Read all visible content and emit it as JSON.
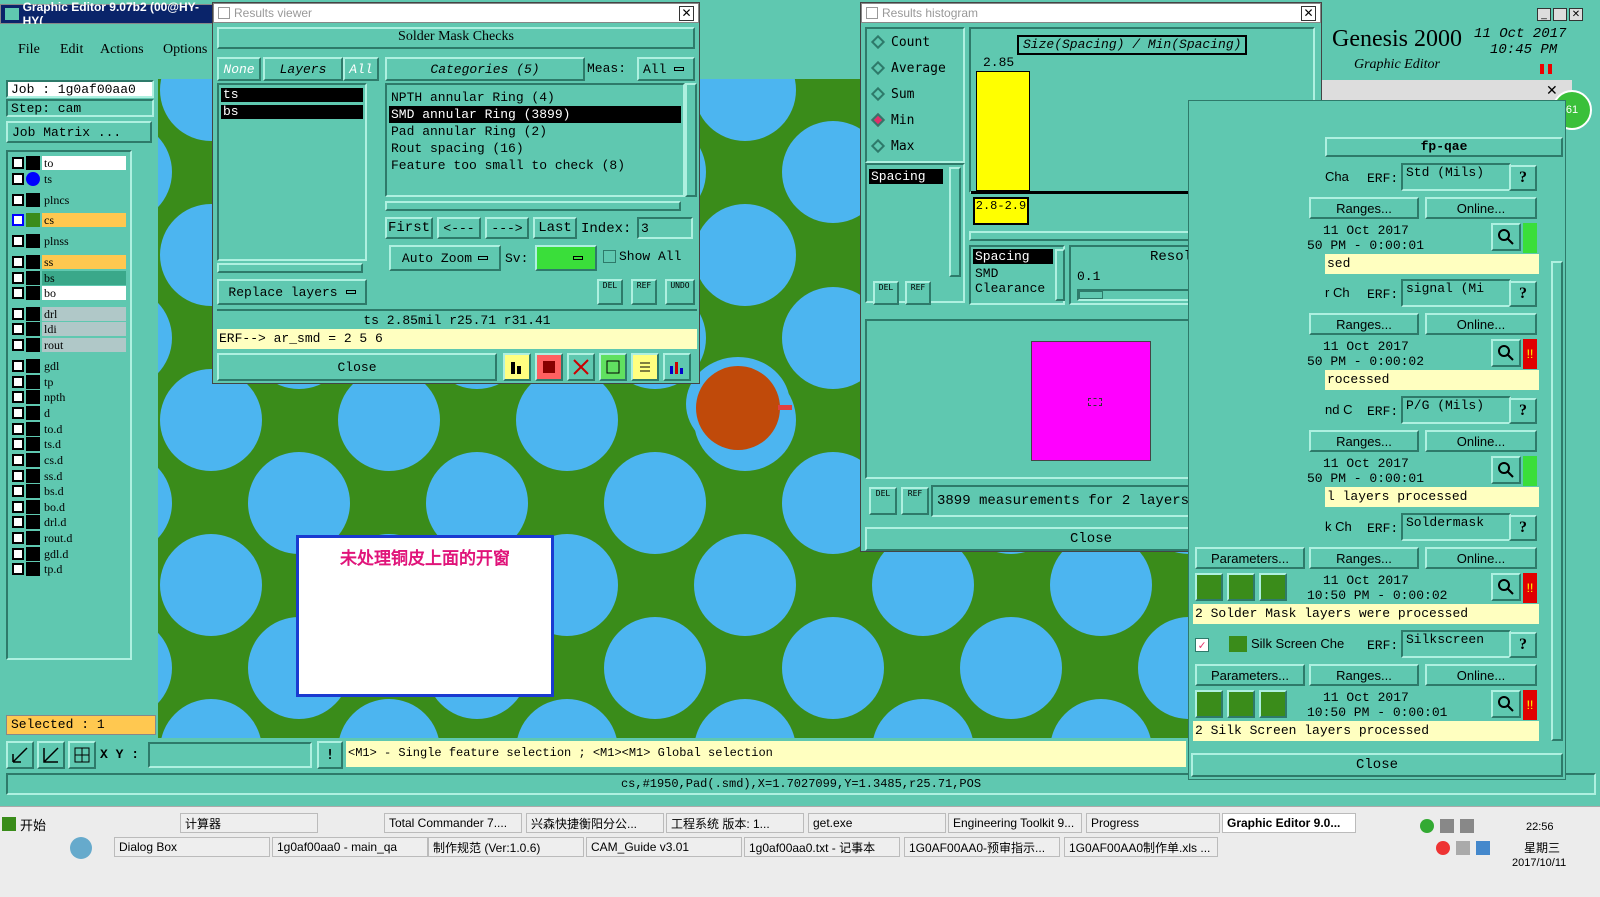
{
  "main": {
    "title": "Graphic Editor 9.07b2 (00@HY-HY(",
    "menu": [
      "File",
      "Edit",
      "Actions",
      "Options"
    ],
    "job": "Job : 1g0af00aa0",
    "step": "Step: cam",
    "job_matrix": "Job Matrix ...",
    "selected": "Selected : 1",
    "xy_label": "X Y :",
    "xy_value": "",
    "hint": "<M1> - Single feature selection ; <M1><M1> Global selection",
    "status": "cs,#1950,Pad(.smd),X=1.7027099,Y=1.3485,r25.71,POS",
    "annotation": "未处理铜皮上面的开窗"
  },
  "layers": [
    "to",
    "ts",
    "plncs",
    "cs",
    "plnss",
    "ss",
    "bs",
    "bo",
    "drl",
    "ldi",
    "rout",
    "gdl",
    "tp",
    "npth",
    "d",
    "to.d",
    "ts.d",
    "cs.d",
    "ss.d",
    "bs.d",
    "bo.d",
    "drl.d",
    "rout.d",
    "gdl.d",
    "tp.d"
  ],
  "results_viewer": {
    "title": "Results viewer",
    "heading": "Solder Mask Checks",
    "tab_none": "None",
    "tab_layers": "Layers",
    "tab_all": "All",
    "categories_label": "Categories (5)",
    "meas_label": "Meas:",
    "meas_value": "All",
    "layer_list": [
      "ts",
      "bs"
    ],
    "categories": [
      "NPTH annular Ring (4)",
      "SMD annular Ring (3899)",
      "Pad annular Ring (2)",
      "Rout spacing (16)",
      "Feature too small to check (8)"
    ],
    "first": "First",
    "prev": "<---",
    "next": "--->",
    "last": "Last",
    "index_label": "Index:",
    "index_value": "3",
    "auto_zoom": "Auto Zoom",
    "sv": "Sv:",
    "show_all": "Show All",
    "replace_layers": "Replace layers",
    "del": "DEL",
    "ref": "REF",
    "undo": "UNDO",
    "result": "ts 2.85mil   r25.71   r31.41",
    "erf": "ERF--> ar_smd = 2 5 6",
    "close": "Close"
  },
  "histogram": {
    "title": "Results histogram",
    "stats": [
      "Count",
      "Average",
      "Sum",
      "Min",
      "Max"
    ],
    "selected_stat": "Min",
    "chart_title": "Size(Spacing) / Min(Spacing)",
    "bar_value": "2.85",
    "bar_range": "2.8-2.9",
    "type_list": [
      "Spacing"
    ],
    "measure_list": [
      "Spacing",
      "SMD",
      "Clearance"
    ],
    "resolution_label": "Resolution",
    "resolution_value": "0.1",
    "measurements": "3899 measurements for 2 layers",
    "close": "Close",
    "del": "DEL",
    "ref": "REF"
  },
  "genesis": {
    "title": "Genesis 2000",
    "subtitle": "Graphic Editor",
    "date": "11 Oct 2017",
    "time": "10:45 PM",
    "panel": "fp-qae",
    "erf_label": "ERF:",
    "ranges": "Ranges...",
    "online": "Online...",
    "parameters": "Parameters...",
    "close": "Close",
    "badge": "61",
    "rows": [
      {
        "name": "Cha",
        "erf": "Std (Mils)",
        "date": "11 Oct 2017",
        "time": "50 PM - 0:00:01",
        "status": "sed",
        "flag": "green"
      },
      {
        "name": "r Ch",
        "erf": "signal (Mi",
        "date": "11 Oct 2017",
        "time": "50 PM - 0:00:02",
        "status": "rocessed",
        "flag": "red"
      },
      {
        "name": "nd C",
        "erf": "P/G (Mils)",
        "date": "11 Oct 2017",
        "time": "50 PM - 0:00:01",
        "status": "l layers processed",
        "flag": "green"
      },
      {
        "name": "k Ch",
        "erf": "Soldermask",
        "date": "11 Oct 2017",
        "time": "10:50 PM - 0:00:02",
        "status": "2 Solder Mask layers were processed",
        "flag": "red"
      },
      {
        "name": "Silk Screen Che",
        "erf": "Silkscreen",
        "date": "11 Oct 2017",
        "time": "10:50 PM - 0:00:01",
        "status": "2 Silk Screen layers processed",
        "flag": "red"
      }
    ]
  },
  "taskbar": {
    "start": "开始",
    "row1": [
      "计算器",
      "Total Commander 7....",
      "兴森快捷衡阳分公...",
      "工程系统  版本: 1...",
      "get.exe",
      "Engineering Toolkit 9...",
      "Progress",
      "Graphic Editor 9.0..."
    ],
    "row2": [
      "Dialog Box",
      "1g0af00aa0 - main_qa",
      "制作规范 (Ver:1.0.6)",
      "CAM_Guide v3.01",
      "1g0af00aa0.txt - 记事本",
      "1G0AF00AA0-预审指示...",
      "1G0AF00AA0制作单.xls ..."
    ],
    "clock": "22:56",
    "weekday": "星期三",
    "date": "2017/10/11"
  },
  "colors": {
    "teal": "#5fc8b0",
    "board": "#3a8c1a",
    "pad": "#4cb5f0",
    "selected_pad": "#c04a0a",
    "magenta": "#ff00ff",
    "yellow": "#ffff00"
  }
}
